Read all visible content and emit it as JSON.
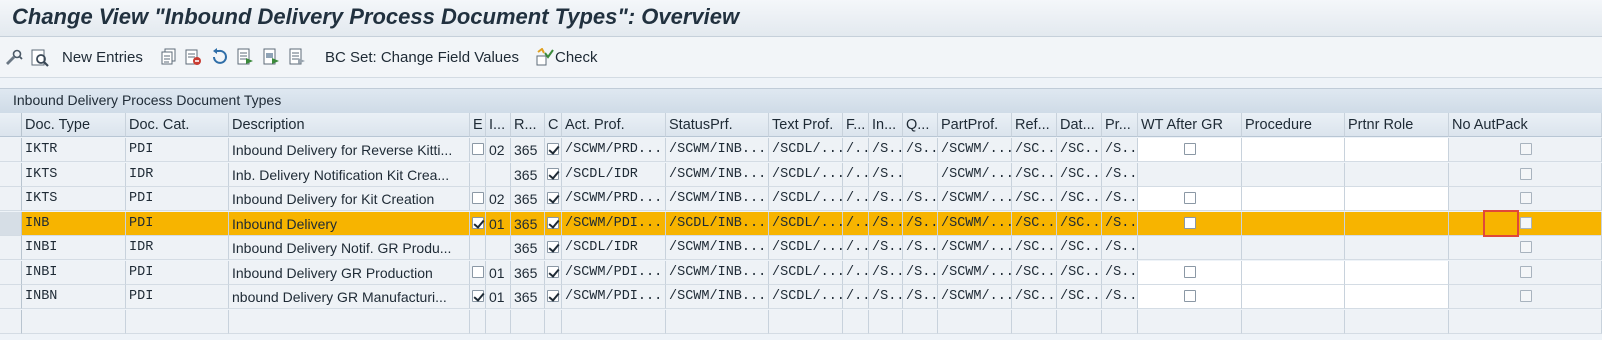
{
  "title": "Change View \"Inbound Delivery Process Document Types\": Overview",
  "toolbar": {
    "new_entries": "New Entries",
    "bc_set": "BC Set: Change Field Values",
    "check": "Check",
    "icons": [
      "display-change-icon",
      "find-icon",
      "copy-icon",
      "delete-icon",
      "undo-icon",
      "select-all-icon",
      "select-block-icon",
      "deselect-all-icon",
      "check-icon"
    ]
  },
  "section_title": "Inbound Delivery Process Document Types",
  "table": {
    "headers": [
      "Doc. Type",
      "Doc. Cat.",
      "Description",
      "E",
      "I...",
      "R...",
      "C",
      "Act. Prof.",
      "StatusPrf.",
      "Text Prof.",
      "F...",
      "In...",
      "Q...",
      "PartProf.",
      "Ref...",
      "Dat...",
      "Pr...",
      "WT After GR",
      "Procedure",
      "Prtnr Role",
      "No AutPack"
    ],
    "rows": [
      {
        "doc_type": "IKTR",
        "doc_cat": "PDI",
        "description": "Inbound Delivery for Reverse Kitti...",
        "e_checked": false,
        "e_show": true,
        "i": "02",
        "r": "365",
        "c_checked": true,
        "act_prof": "/SCWM/PRD...",
        "status_prf": "/SCWM/INB...",
        "text_prof": "/SCDL/...",
        "f": "/...",
        "in": "/S...",
        "q": "/S...",
        "part_prof": "/SCWM/...",
        "ref": "/SC...",
        "dat": "/SC...",
        "pr": "/S...",
        "wt_show": true,
        "wt_checked": false,
        "no_autpack": false
      },
      {
        "doc_type": "IKTS",
        "doc_cat": "IDR",
        "description": "Inb. Delivery Notification Kit Crea...",
        "e_checked": false,
        "e_show": false,
        "i": "",
        "r": "365",
        "c_checked": true,
        "act_prof": "/SCDL/IDR",
        "status_prf": "/SCWM/INB...",
        "text_prof": "/SCDL/...",
        "f": "/...",
        "in": "/S...",
        "q": "",
        "part_prof": "/SCWM/...",
        "ref": "/SC...",
        "dat": "/SC...",
        "pr": "/S...",
        "wt_show": false,
        "wt_checked": false,
        "no_autpack": false
      },
      {
        "doc_type": "IKTS",
        "doc_cat": "PDI",
        "description": "Inbound Delivery for Kit Creation",
        "e_checked": false,
        "e_show": true,
        "i": "02",
        "r": "365",
        "c_checked": true,
        "act_prof": "/SCWM/PRD...",
        "status_prf": "/SCWM/INB...",
        "text_prof": "/SCDL/...",
        "f": "/...",
        "in": "/S...",
        "q": "/S...",
        "part_prof": "/SCWM/...",
        "ref": "/SC...",
        "dat": "/SC...",
        "pr": "/S...",
        "wt_show": true,
        "wt_checked": false,
        "no_autpack": false
      },
      {
        "doc_type": "INB",
        "doc_cat": "PDI",
        "description": "Inbound Delivery",
        "e_checked": true,
        "e_show": true,
        "i": "01",
        "r": "365",
        "c_checked": true,
        "act_prof": "/SCWM/PDI...",
        "status_prf": "/SCDL/INB...",
        "text_prof": "/SCDL/...",
        "f": "/...",
        "in": "/S...",
        "q": "/S...",
        "part_prof": "/SCWM/...",
        "ref": "/SC...",
        "dat": "/SC...",
        "pr": "/S...",
        "wt_show": true,
        "wt_checked": false,
        "no_autpack": false
      },
      {
        "doc_type": "INBI",
        "doc_cat": "IDR",
        "description": "Inbound Delivery Notif. GR Produ...",
        "e_checked": false,
        "e_show": false,
        "i": "",
        "r": "365",
        "c_checked": true,
        "act_prof": "/SCDL/IDR",
        "status_prf": "/SCWM/INB...",
        "text_prof": "/SCDL/...",
        "f": "/...",
        "in": "/S...",
        "q": "/S...",
        "part_prof": "/SCWM/...",
        "ref": "/SC...",
        "dat": "/SC...",
        "pr": "/S...",
        "wt_show": false,
        "wt_checked": false,
        "no_autpack": false
      },
      {
        "doc_type": "INBI",
        "doc_cat": "PDI",
        "description": "Inbound Delivery GR Production",
        "e_checked": false,
        "e_show": true,
        "i": "01",
        "r": "365",
        "c_checked": true,
        "act_prof": "/SCWM/PDI...",
        "status_prf": "/SCWM/INB...",
        "text_prof": "/SCDL/...",
        "f": "/...",
        "in": "/S...",
        "q": "/S...",
        "part_prof": "/SCWM/...",
        "ref": "/SC...",
        "dat": "/SC...",
        "pr": "/S...",
        "wt_show": true,
        "wt_checked": false,
        "no_autpack": false
      },
      {
        "doc_type": "INBN",
        "doc_cat": "PDI",
        "description": "nbound Delivery GR Manufacturi...",
        "e_checked": true,
        "e_show": true,
        "i": "01",
        "r": "365",
        "c_checked": true,
        "act_prof": "/SCWM/PDI...",
        "status_prf": "/SCWM/INB...",
        "text_prof": "/SCDL/...",
        "f": "/...",
        "in": "/S...",
        "q": "/S...",
        "part_prof": "/SCWM/...",
        "ref": "/SC...",
        "dat": "/SC...",
        "pr": "/S...",
        "wt_show": true,
        "wt_checked": false,
        "no_autpack": false
      }
    ]
  }
}
